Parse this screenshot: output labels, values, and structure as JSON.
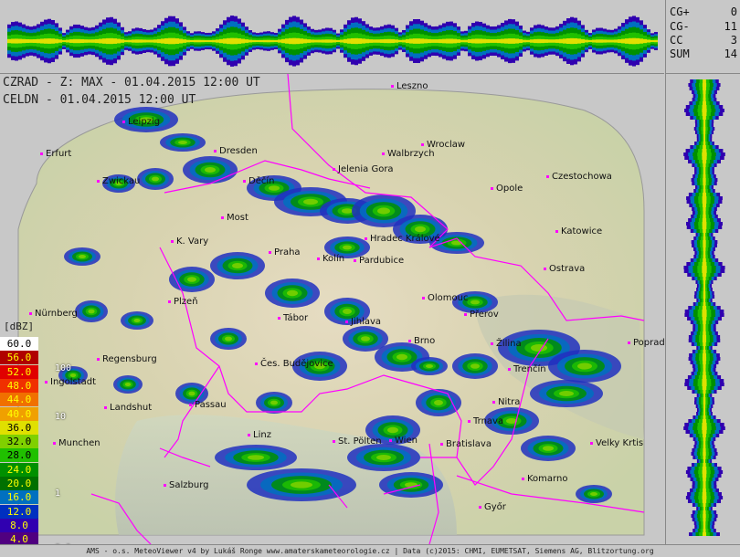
{
  "stats": [
    {
      "key": "CG+",
      "value": "0"
    },
    {
      "key": "CG-",
      "value": "11"
    },
    {
      "key": "CC",
      "value": "3"
    },
    {
      "key": "SUM",
      "value": "14"
    }
  ],
  "titles": {
    "line1": "CZRAD - Z: MAX - 01.04.2015 12:00 UT",
    "line2": "CELDN - 01.04.2015 12:00 UT"
  },
  "legend": {
    "title": "[dBZ]",
    "entries": [
      {
        "label": "60.0",
        "color": "#ffffff",
        "text_color": "#000000"
      },
      {
        "label": "56.0",
        "color": "#b00000",
        "text_color": "#ffff00"
      },
      {
        "label": "52.0",
        "color": "#e00000",
        "text_color": "#ffff00"
      },
      {
        "label": "48.0",
        "color": "#f03000",
        "text_color": "#ffff00"
      },
      {
        "label": "44.0",
        "color": "#f07000",
        "text_color": "#ffff00"
      },
      {
        "label": "40.0",
        "color": "#f0a000",
        "text_color": "#ffff00"
      },
      {
        "label": "36.0",
        "color": "#e0e000",
        "text_color": "#000000"
      },
      {
        "label": "32.0",
        "color": "#80d000",
        "text_color": "#000000"
      },
      {
        "label": "28.0",
        "color": "#20c000",
        "text_color": "#000000"
      },
      {
        "label": "24.0",
        "color": "#009000",
        "text_color": "#ffff00"
      },
      {
        "label": "20.0",
        "color": "#007000",
        "text_color": "#ffff00"
      },
      {
        "label": "16.0",
        "color": "#0070c0",
        "text_color": "#ffff00"
      },
      {
        "label": "12.0",
        "color": "#0030c0",
        "text_color": "#ffff00"
      },
      {
        "label": "8.0",
        "color": "#3000b0",
        "text_color": "#ffff00"
      },
      {
        "label": "4.0",
        "color": "#500080",
        "text_color": "#ffff00"
      }
    ],
    "rain_scale": [
      "100",
      "10",
      "1",
      "0.1"
    ]
  },
  "cities": [
    {
      "name": "Leszno"
    },
    {
      "name": "Wroclaw"
    },
    {
      "name": "Opole"
    },
    {
      "name": "Czestochowa"
    },
    {
      "name": "Katowice"
    },
    {
      "name": "Jelenia Gora"
    },
    {
      "name": "Walbrzych"
    },
    {
      "name": "Dresden"
    },
    {
      "name": "Erfurt"
    },
    {
      "name": "Zwickau"
    },
    {
      "name": "Most"
    },
    {
      "name": "Děčín"
    },
    {
      "name": "K. Vary"
    },
    {
      "name": "Praha"
    },
    {
      "name": "Kolín"
    },
    {
      "name": "Pardubice"
    },
    {
      "name": "Hradec Králové"
    },
    {
      "name": "Olomouc"
    },
    {
      "name": "Přerov"
    },
    {
      "name": "Ostrava"
    },
    {
      "name": "Žilina"
    },
    {
      "name": "Poprad"
    },
    {
      "name": "Trenčín"
    },
    {
      "name": "Brno"
    },
    {
      "name": "Jihlava"
    },
    {
      "name": "Tábor"
    },
    {
      "name": "Plzeň"
    },
    {
      "name": "Regensburg"
    },
    {
      "name": "Ingolstadt"
    },
    {
      "name": "Landshut"
    },
    {
      "name": "Passau"
    },
    {
      "name": "Čes. Budějovice"
    },
    {
      "name": "Linz"
    },
    {
      "name": "St. Pölten"
    },
    {
      "name": "Wien"
    },
    {
      "name": "Bratislava"
    },
    {
      "name": "Trnava"
    },
    {
      "name": "Nitra"
    },
    {
      "name": "Komarno"
    },
    {
      "name": "Győr"
    },
    {
      "name": "Velky Krtis"
    },
    {
      "name": "Munchen"
    },
    {
      "name": "Salzburg"
    },
    {
      "name": "Nürnberg"
    },
    {
      "name": "Leipzig"
    }
  ],
  "footer": "AMS - o.s. MeteoViewer v4 by Lukáš Ronge www.amaterskameteorologie.cz | Data (c)2015: CHMI, EUMETSAT, Siemens AG, Blitzortung.org"
}
